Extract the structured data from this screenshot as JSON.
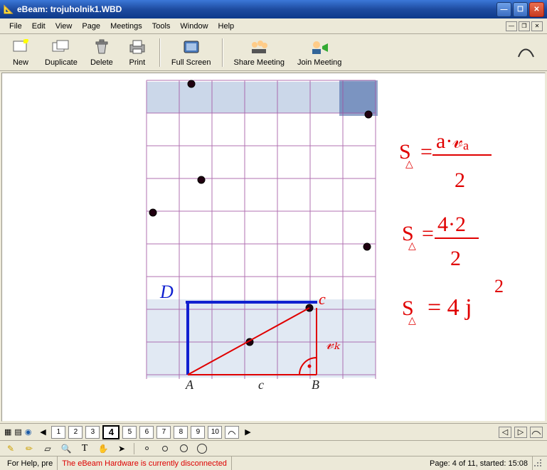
{
  "window": {
    "title": "eBeam: trojuholnik1.WBD"
  },
  "menus": [
    "File",
    "Edit",
    "View",
    "Page",
    "Meetings",
    "Tools",
    "Window",
    "Help"
  ],
  "toolbar": {
    "new": "New",
    "duplicate": "Duplicate",
    "delete": "Delete",
    "print": "Print",
    "fullscreen": "Full Screen",
    "share": "Share Meeting",
    "join": "Join Meeting"
  },
  "pages": {
    "items": [
      "1",
      "2",
      "3",
      "4",
      "5",
      "6",
      "7",
      "8",
      "9",
      "10"
    ],
    "current": 4
  },
  "status": {
    "help": "For Help, pre",
    "warning": "The eBeam Hardware is currently disconnected",
    "page": "Page: 4 of 11, started: 15:08"
  },
  "canvas": {
    "labels": {
      "A": "A",
      "B": "B",
      "C": "c",
      "D": "D",
      "c_bottom": "c",
      "vc": "𝓋ₖ"
    },
    "formulas": {
      "line1a": "S",
      "line1b": "=",
      "line1c": "a·𝓋ₐ",
      "line1d": "2",
      "line2a": "S",
      "line2b": "=",
      "line2c": "4·2",
      "line2d": "2",
      "line3a": "S",
      "line3b": "= 4 j",
      "line3c": "2"
    }
  }
}
